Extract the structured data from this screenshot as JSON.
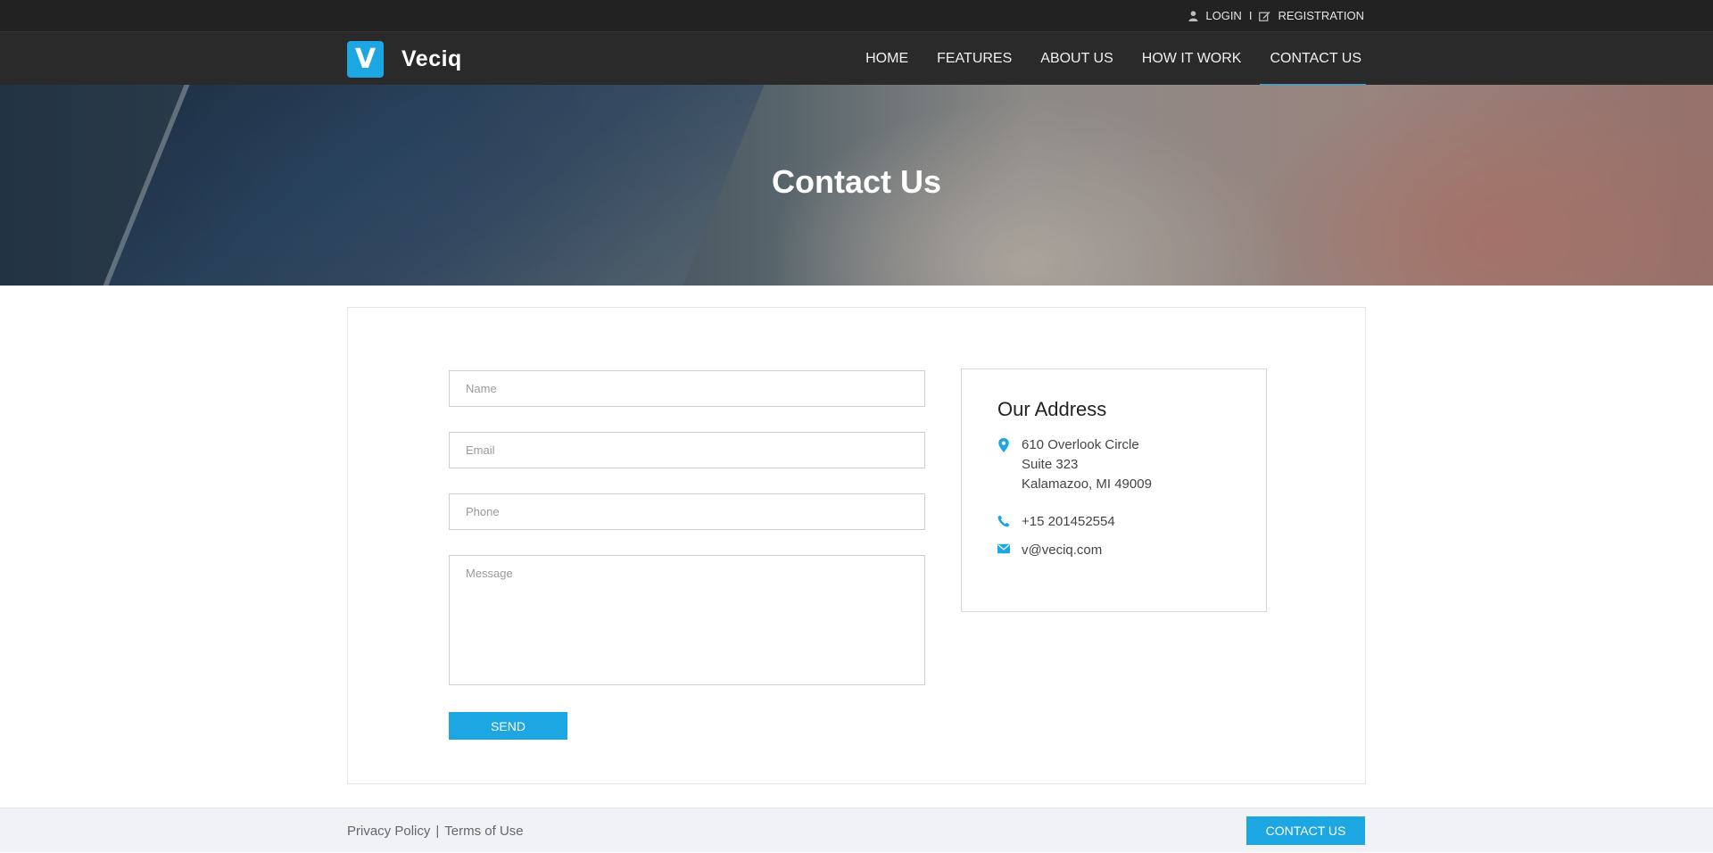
{
  "topbar": {
    "login_label": "LOGIN",
    "separator": "I",
    "registration_label": "REGISTRATION"
  },
  "brand": {
    "badge_letter": "V",
    "name": "Veciq",
    "accent_color": "#1ca7e2"
  },
  "nav": {
    "items": [
      {
        "label": "HOME"
      },
      {
        "label": "FEATURES"
      },
      {
        "label": "ABOUT US"
      },
      {
        "label": "HOW IT WORK"
      },
      {
        "label": "CONTACT US",
        "active": true
      }
    ]
  },
  "hero": {
    "title": "Contact Us"
  },
  "form": {
    "name_placeholder": "Name",
    "email_placeholder": "Email",
    "phone_placeholder": "Phone",
    "message_placeholder": "Message",
    "send_label": "SEND"
  },
  "address": {
    "title": "Our Address",
    "street": "610 Overlook Circle",
    "suite": "Suite 323",
    "city": "Kalamazoo, MI 49009",
    "phone": "+15 201452554",
    "email": "v@veciq.com"
  },
  "footer": {
    "privacy_label": "Privacy Policy",
    "separator": "|",
    "terms_label": "Terms of Use",
    "contact_label": "CONTACT US"
  }
}
